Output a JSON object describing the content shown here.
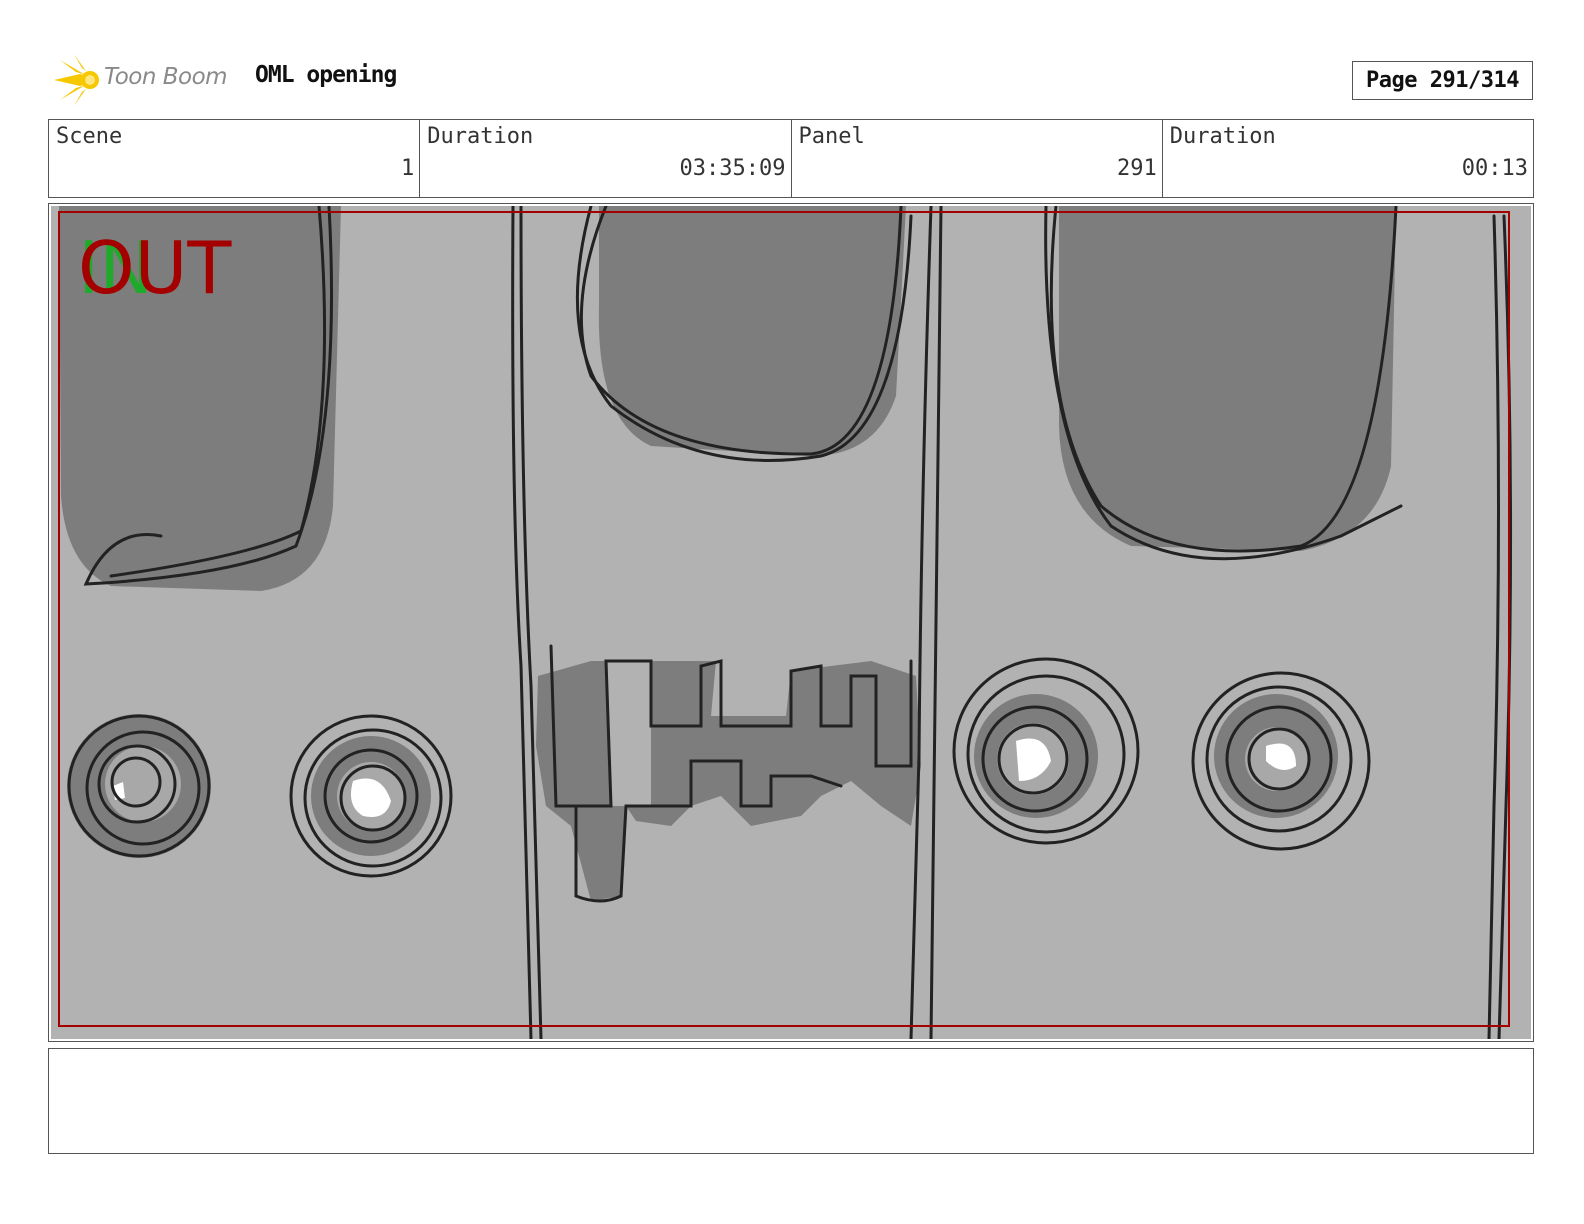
{
  "header": {
    "logo_text": "Toon Boom",
    "project_title": "OML opening",
    "page_label": "Page 291/314"
  },
  "info": {
    "scene_label": "Scene",
    "scene_value": "1",
    "scene_duration_label": "Duration",
    "scene_duration_value": "03:35:09",
    "panel_label": "Panel",
    "panel_value": "291",
    "panel_duration_label": "Duration",
    "panel_duration_value": "00:13"
  },
  "panel": {
    "marker_in": "IN",
    "marker_out": "OUT"
  },
  "colors": {
    "logo_yellow": "#f5c800",
    "in_green": "#1faa2c",
    "out_red": "#a40000",
    "background_gray": "#b2b2b2",
    "shape_gray": "#7d7d7d"
  },
  "notes": ""
}
